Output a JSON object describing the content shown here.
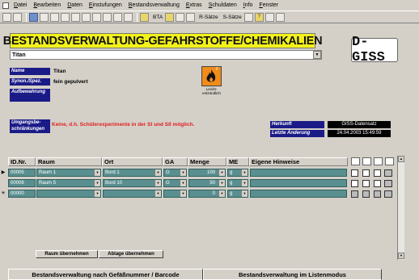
{
  "menubar": {
    "items": [
      "Datei",
      "Bearbeiten",
      "Daten",
      "Einstufungen",
      "Bestandsverwaltung",
      "Extras",
      "Schuldaten",
      "Info",
      "Fenster"
    ]
  },
  "toolbar": {
    "bta_label": "BTA",
    "rsatze_label": "R-Sätze",
    "ssatze_label": "S-Sätze"
  },
  "header": {
    "title": "BESTANDSVERWALTUNG-GEFAHRSTOFFE/CHEMIKALIEN",
    "logo": "D-GISS"
  },
  "substance": {
    "combo_value": "Titan"
  },
  "details": {
    "name_label": "Name",
    "name_value": "Titan",
    "synonym_label": "Synon./Spez.",
    "synonym_value": "fein gepulvert",
    "storage_label": "Aufbewahrung",
    "storage_value": "",
    "hazard_symbol": "flame-icon",
    "hazard_letter": "F",
    "hazard_caption": "Leicht-entzündlich",
    "restrictions_label": "Umgangsbe-schränkungen",
    "restrictions_value": "Keine, d.h. Schülerexperimente in der SI und SII möglich.",
    "source_label": "Herkunft",
    "source_value": "GISS-Datensatz",
    "lastchange_label": "Letzte Änderung",
    "lastchange_value": "24.04.2003 15:49:59"
  },
  "table": {
    "headers": [
      "ID.Nr.",
      "Raum",
      "Ort",
      "GA",
      "Menge",
      "ME",
      "Eigene Hinweise"
    ],
    "rows": [
      {
        "selector": "▶",
        "id": "00005",
        "raum": "Raum 1",
        "ort": "Bord 1",
        "ga": "G",
        "menge": "100",
        "me": "g",
        "hinweise": ""
      },
      {
        "selector": "",
        "id": "00006",
        "raum": "Raum 5",
        "ort": "Bord 10",
        "ga": "G",
        "menge": "50",
        "me": "g",
        "hinweise": ""
      },
      {
        "selector": "✳",
        "id": "00000",
        "raum": "",
        "ort": "",
        "ga": "",
        "menge": "0",
        "me": "g",
        "hinweise": ""
      }
    ]
  },
  "buttons": {
    "raum_label": "Raum übernehmen",
    "ablage_label": "Ablage übernehmen"
  },
  "tabs": {
    "left_label": "Bestandsverwaltung nach Gefäßnummer / Barcode",
    "right_label": "Bestandsverwaltung im Listenmodus"
  }
}
